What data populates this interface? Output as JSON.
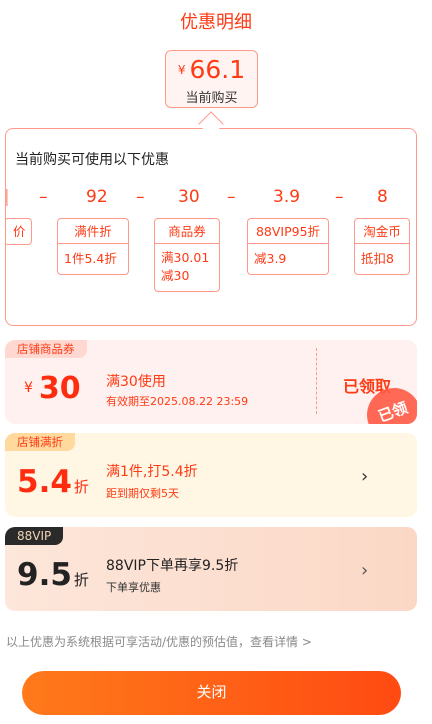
{
  "header": {
    "title": "优惠明细"
  },
  "current_purchase": {
    "currency": "¥",
    "price": "66.1",
    "label": "当前购买"
  },
  "panel": {
    "title": "当前购买可使用以下优惠",
    "calc": [
      "–",
      "92",
      "–",
      "30",
      "–",
      "3.9",
      "–",
      "8"
    ],
    "boxes": [
      {
        "title": "价",
        "lines": []
      },
      {
        "title": "满件折",
        "lines": [
          "1件5.4折"
        ]
      },
      {
        "title": "商品券",
        "lines": [
          "满30.01",
          "减30"
        ]
      },
      {
        "title": "88VIP95折",
        "lines": [
          "减3.9"
        ]
      },
      {
        "title": "淘金币",
        "lines": [
          "抵扣8"
        ]
      }
    ]
  },
  "cards": {
    "store_coupon": {
      "tag": "店铺商品券",
      "currency": "¥",
      "amount": "30",
      "condition": "满30使用",
      "validity": "有效期至2025.08.22 23:59",
      "status": "已领取",
      "stamp": "已领"
    },
    "store_discount": {
      "tag": "店铺满折",
      "amount": "5.4",
      "unit": "折",
      "condition": "满1件,打5.4折",
      "sub": "距到期仅剩5天",
      "chevron": "›"
    },
    "vip": {
      "tag": "88VIP",
      "amount": "9.5",
      "unit": "折",
      "condition": "88VIP下单再享9.5折",
      "sub": "下单享优惠",
      "chevron": "›"
    }
  },
  "footnote": "以上优惠为系统根据可享活动/优惠的预估值，查看详情 >",
  "close_button": "关闭"
}
